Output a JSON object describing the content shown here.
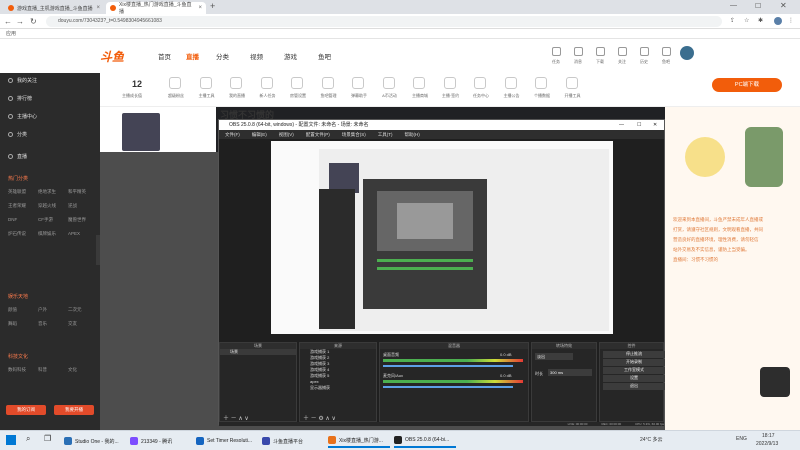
{
  "browser": {
    "tabs": [
      {
        "title": "游戏直播_主机游戏直播_斗鱼直播"
      },
      {
        "title": "Xix楼直播_热门游戏直播_斗鱼直播"
      }
    ],
    "new_tab": "+",
    "url": "douyu.com/7304323?_t=0.5498304945661083",
    "bookmarks": "应用"
  },
  "site": {
    "logo": "斗鱼",
    "nav": [
      "首页",
      "直播",
      "分类",
      "视频",
      "游戏",
      "鱼吧"
    ],
    "active_nav": "直播",
    "header_labels": [
      "任务",
      "消息",
      "下载",
      "关注",
      "历史",
      "鱼吧",
      "充值"
    ],
    "pc_button": "PC端下载",
    "subbar": {
      "count": "12",
      "count_label": "主播成长值",
      "items": [
        "超级粉丝",
        "主播工具",
        "我的直播",
        "新人任务",
        "房管设置",
        "鱼吧管理",
        "弹幕助手",
        "A币活动",
        "主播商城",
        "主播·签约",
        "任务中心",
        "主播公告",
        "个播数据",
        "开播工具"
      ]
    },
    "stream_title": "习惯不习惯的"
  },
  "sidebar": {
    "items": [
      "我的关注",
      "排行榜",
      "主播中心",
      "分类",
      "直播"
    ],
    "section1": "热门分类",
    "grid1": [
      "英雄联盟",
      "绝地求生",
      "和平精英",
      "王者荣耀",
      "穿越火线",
      "逆战",
      "DNF",
      "CF手游",
      "魔兽世界",
      "炉石传说",
      "棋牌娱乐",
      "APEX"
    ],
    "section2": "娱乐天地",
    "grid2": [
      "颜值",
      "户外",
      "二次元",
      "舞蹈",
      "音乐",
      "交友"
    ],
    "section3": "科技文化",
    "grid3": [
      "数码科技",
      "科普",
      "文化"
    ],
    "btn_left": "我的订阅",
    "btn_right": "我要开播"
  },
  "chat": {
    "lines": [
      "欢迎来到本直播间，斗鱼严禁未成年人直播或",
      "打赏，请遵守社区规则，文明观看直播，共同",
      "营造良好的直播环境，理性消费，请勿轻信",
      "站外交易及不实信息，谨防上当受骗。",
      "直播间：习惯不习惯的"
    ]
  },
  "obs": {
    "title": "OBS 25.0.8 (64-bit, windows) - 配置文件: 未命名 - 场景: 未命名",
    "menu": [
      "文件(F)",
      "编辑(E)",
      "视图(V)",
      "配置文件(P)",
      "场景集合(S)",
      "工具(T)",
      "帮助(H)"
    ],
    "panels": {
      "scenes": {
        "title": "场景",
        "items": [
          "场景"
        ]
      },
      "sources": {
        "title": "来源",
        "items": [
          "游戏捕获 1",
          "游戏捕获 2",
          "游戏捕获 3",
          "游戏捕获 4",
          "游戏捕获 5",
          "apex",
          "显示器捕获"
        ]
      },
      "mixer": {
        "title": "混音器",
        "tracks": [
          {
            "name": "桌面音频",
            "db": "0.0 dB"
          },
          {
            "name": "麦克风/Aux",
            "db": "0.0 dB"
          }
        ]
      },
      "transitions": {
        "title": "转场特效",
        "type": "淡出",
        "duration_label": "时长",
        "duration": "300 ms"
      },
      "controls": {
        "title": "控件",
        "buttons": [
          "停止推流",
          "开始录制",
          "工作室模式",
          "设置",
          "退出"
        ]
      }
    },
    "status": [
      "LIVE: 00:00:00",
      "REC: 00:00:00",
      "CPU: 5.3%, 60.00 fps"
    ]
  },
  "taskbar": {
    "apps": [
      "Studio One - 我的...",
      "213349 - 腾讯",
      "Set Timer Resoluti...",
      "斗鱼直播平台",
      "Xix楼直播_热门游...",
      "OBS 25.0.8 (64-bi..."
    ],
    "weather": "24°C 多云",
    "lang": "ENG",
    "time": "18:17",
    "date": "2022/9/13"
  },
  "colors": {
    "accent": "#f25d0b",
    "sidebar": "#2b2b2b"
  }
}
